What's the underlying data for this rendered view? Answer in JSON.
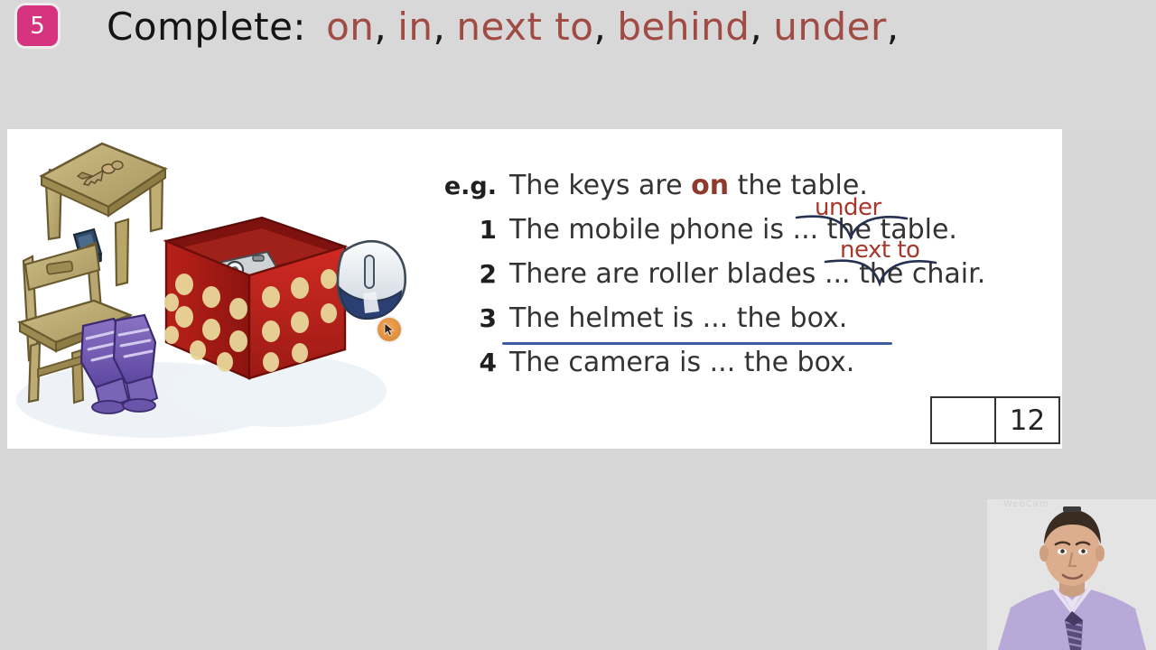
{
  "header": {
    "exercise_number": "5",
    "instruction_label": "Complete:",
    "word_bank": [
      "on",
      "in",
      "next to",
      "behind",
      "under"
    ],
    "separator": ","
  },
  "worksheet": {
    "example": {
      "marker": "e.g.",
      "text_before": "The keys are ",
      "answer": "on",
      "text_after": " the table."
    },
    "questions": [
      {
        "number": "1",
        "text": "The mobile phone is ... the table.",
        "annotation": "under",
        "has_caret": true,
        "underlined": false
      },
      {
        "number": "2",
        "text": "There are roller blades ... the chair.",
        "annotation": "next to",
        "has_caret": true,
        "underlined": false
      },
      {
        "number": "3",
        "text": "The helmet is ... the box.",
        "annotation": "",
        "has_caret": false,
        "underlined": true
      },
      {
        "number": "4",
        "text": "The camera is ... the box.",
        "annotation": "",
        "has_caret": false,
        "underlined": false
      }
    ],
    "score_box": {
      "blank": "",
      "total": "12"
    }
  },
  "illustration": {
    "alt": "A wooden table with keys on top, a mobile phone under the table, a wooden chair, purple roller blades next to the chair, a red spotted box with a camera inside, and a white-and-blue helmet behind the box.",
    "items": [
      "table",
      "keys",
      "mobile-phone",
      "chair",
      "roller-blades",
      "red-spotted-box",
      "camera",
      "helmet"
    ]
  },
  "cursor": {
    "icon": "pointer-arrow"
  },
  "webcam": {
    "watermark": "WebCam",
    "presenter_alt": "Presenter wearing a lavender shirt and a striped tie"
  },
  "colors": {
    "badge": "#d6337f",
    "word_bank": "#a04b43",
    "answer": "#8e3a2c",
    "annotation_red": "#a8372b",
    "annotation_caret": "#26304f",
    "underline_blue": "#3f5c9e",
    "page_background": "#d7d7d7",
    "panel_background": "#ffffff",
    "cursor": "#e1913f"
  }
}
